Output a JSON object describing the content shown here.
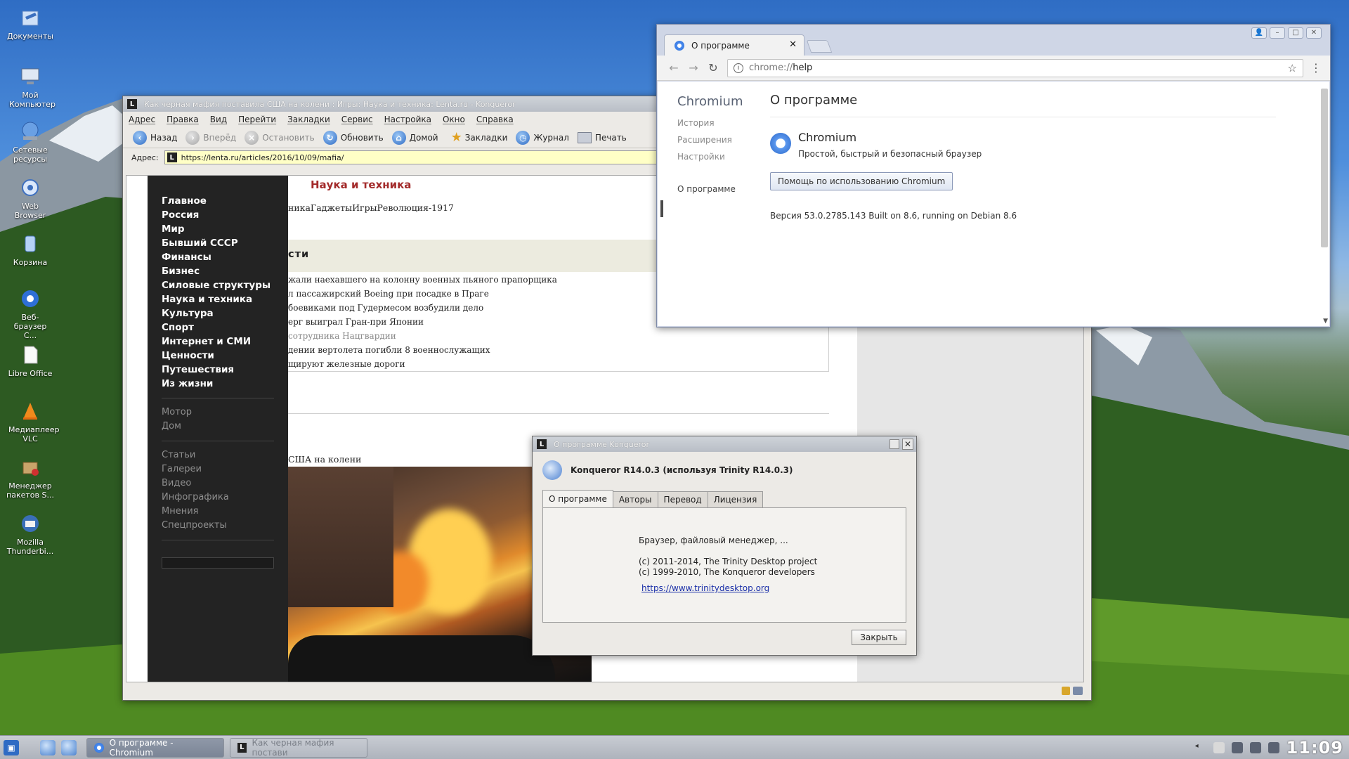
{
  "desktop_icons": [
    {
      "label": "Документы",
      "icon": "folder-documents-icon"
    },
    {
      "label": "Мой Компьютер",
      "icon": "computer-icon"
    },
    {
      "label": "Сетевые ресурсы",
      "icon": "network-icon"
    },
    {
      "label": "Web Browser",
      "icon": "konqueror-icon"
    },
    {
      "label": "Корзина",
      "icon": "trash-icon"
    },
    {
      "label": "Веб-браузер C...",
      "icon": "chromium-icon"
    },
    {
      "label": "Libre Office",
      "icon": "document-icon"
    },
    {
      "label": "Медиаплеер VLC",
      "icon": "vlc-icon"
    },
    {
      "label": "Менеджер пакетов S...",
      "icon": "package-manager-icon"
    },
    {
      "label": "Mozilla Thunderbi...",
      "icon": "thunderbird-icon"
    }
  ],
  "konqueror": {
    "title": "Как черная мафия поставила США на колени : Игры: Наука и техника: Lenta.ru - Konqueror",
    "menu": [
      "Адрес",
      "Правка",
      "Вид",
      "Перейти",
      "Закладки",
      "Сервис",
      "Настройка",
      "Окно",
      "Справка"
    ],
    "toolbar": {
      "back": "Назад",
      "forward": "Вперёд",
      "stop": "Остановить",
      "reload": "Обновить",
      "home": "Домой",
      "bookmarks": "Закладки",
      "history": "Журнал",
      "print": "Печать"
    },
    "address_label": "Адрес:",
    "url": "https://lenta.ru/articles/2016/10/09/mafia/",
    "page": {
      "section_title": "Наука и техника",
      "nav_main": [
        "Главное",
        "Россия",
        "Мир",
        "Бывший СССР",
        "Финансы",
        "Бизнес",
        "Силовые структуры",
        "Наука и техника",
        "Культура",
        "Спорт",
        "Интернет и СМИ",
        "Ценности",
        "Путешествия",
        "Из жизни"
      ],
      "nav_sub1": [
        "Мотор",
        "Дом"
      ],
      "nav_sub2": [
        "Статьи",
        "Галереи",
        "Видео",
        "Инфографика",
        "Мнения",
        "Спецпроекты"
      ],
      "subnav": "никаГаджетыИгрыРеволюция-1917",
      "news_header": "сти",
      "news": [
        "жали наехавшего на колонну военных пьяного прапорщика",
        "л пассажирский Boeing при посадке в Праге",
        "боевиками под Гудермесом возбудили дело",
        "ерг выиграл Гран-при Японии",
        "сотрудника Нацгвардии",
        "дении вертолета погибли 8 военнослужащих",
        "щируют железные дороги"
      ],
      "article_title": "США на колени"
    }
  },
  "chromium": {
    "tab_title": "О программе",
    "url_scheme": "chrome://",
    "url_path": "help",
    "sidebar_title": "Chromium",
    "sidebar": [
      "История",
      "Расширения",
      "Настройки",
      "О программе"
    ],
    "page_title": "О программе",
    "product": "Chromium",
    "tagline": "Простой, быстрый и безопасный браузер",
    "help_button": "Помощь по использованию Chromium",
    "version": "Версия 53.0.2785.143 Built on 8.6, running on Debian 8.6"
  },
  "about_konqueror": {
    "title": "О программе Konqueror",
    "heading": "Konqueror R14.0.3 (используя Trinity R14.0.3)",
    "tabs": [
      "О программе",
      "Авторы",
      "Перевод",
      "Лицензия"
    ],
    "desc": "Браузер, файловый менеджер, ...",
    "copy1": "(c) 2011-2014, The Trinity Desktop project",
    "copy2": "(c) 1999-2010, The Konqueror developers",
    "link": "https://www.trinitydesktop.org",
    "close": "Закрыть"
  },
  "taskbar": {
    "tasks": [
      "О программе - Chromium",
      "Как черная мафия постави"
    ],
    "clock": "11:09"
  }
}
